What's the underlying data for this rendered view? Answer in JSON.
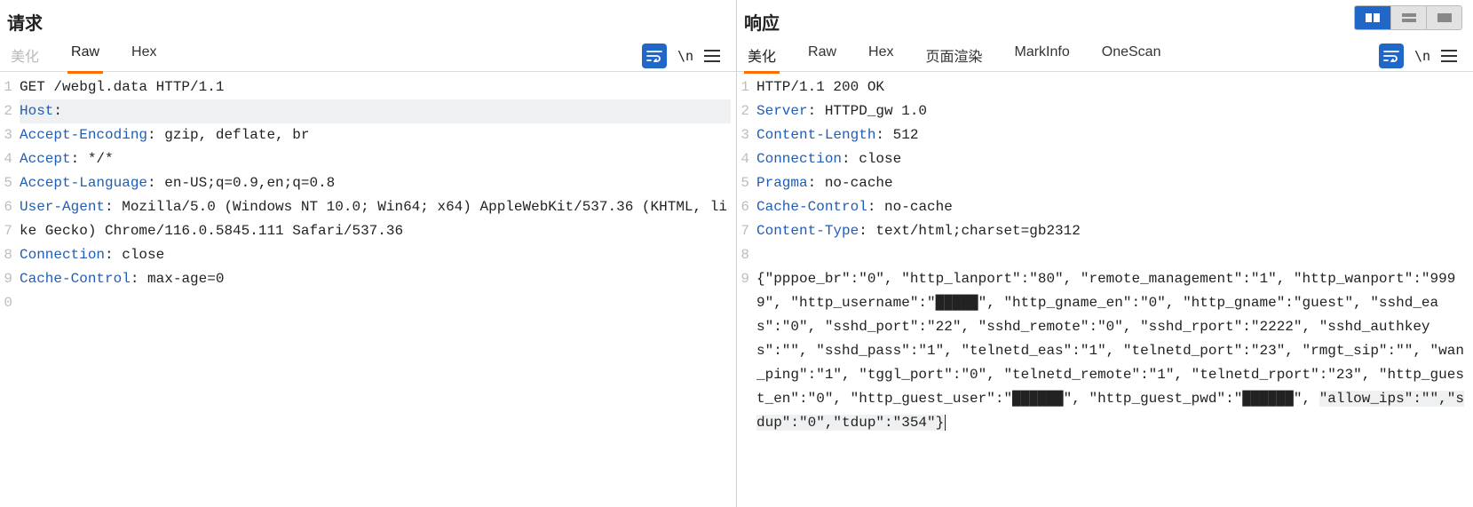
{
  "request": {
    "title": "请求",
    "tabs": [
      {
        "label": "美化",
        "state": "disabled"
      },
      {
        "label": "Raw",
        "state": "active"
      },
      {
        "label": "Hex",
        "state": ""
      }
    ],
    "toolbar": {
      "ln": "\\n"
    },
    "lines": [
      {
        "n": "1",
        "type": "plain",
        "text": "GET /webgl.data HTTP/1.1"
      },
      {
        "n": "2",
        "type": "header",
        "key": "Host",
        "value": "",
        "hl": true
      },
      {
        "n": "3",
        "type": "header",
        "key": "Accept-Encoding",
        "value": "gzip, deflate, br"
      },
      {
        "n": "4",
        "type": "header",
        "key": "Accept",
        "value": "*/*"
      },
      {
        "n": "5",
        "type": "header",
        "key": "Accept-Language",
        "value": "en-US;q=0.9,en;q=0.8"
      },
      {
        "n": "6",
        "type": "header",
        "key": "User-Agent",
        "value": "Mozilla/5.0 (Windows NT 10.0; Win64; x64) AppleWebKit/537.36 (KHTML, like Gecko) Chrome/116.0.5845.111 Safari/537.36"
      },
      {
        "n": "7",
        "type": "header",
        "key": "Connection",
        "value": "close"
      },
      {
        "n": "8",
        "type": "header",
        "key": "Cache-Control",
        "value": "max-age=0"
      },
      {
        "n": "9",
        "type": "plain",
        "text": ""
      },
      {
        "n": "0",
        "type": "plain",
        "text": ""
      }
    ]
  },
  "response": {
    "title": "响应",
    "tabs": [
      {
        "label": "美化",
        "state": "active"
      },
      {
        "label": "Raw",
        "state": ""
      },
      {
        "label": "Hex",
        "state": ""
      },
      {
        "label": "页面渲染",
        "state": ""
      },
      {
        "label": "MarkInfo",
        "state": ""
      },
      {
        "label": "OneScan",
        "state": ""
      }
    ],
    "toolbar": {
      "ln": "\\n"
    },
    "lines": [
      {
        "n": "1",
        "type": "plain",
        "text": "HTTP/1.1 200 OK"
      },
      {
        "n": "2",
        "type": "header",
        "key": "Server",
        "value": "HTTPD_gw 1.0"
      },
      {
        "n": "3",
        "type": "header",
        "key": "Content-Length",
        "value": "512"
      },
      {
        "n": "4",
        "type": "header",
        "key": "Connection",
        "value": "close"
      },
      {
        "n": "5",
        "type": "header",
        "key": "Pragma",
        "value": "no-cache"
      },
      {
        "n": "6",
        "type": "header",
        "key": "Cache-Control",
        "value": "no-cache"
      },
      {
        "n": "7",
        "type": "header",
        "key": "Content-Type",
        "value": "text/html;charset=gb2312"
      },
      {
        "n": "8",
        "type": "plain",
        "text": ""
      }
    ],
    "body_n": "9",
    "body": "{\"pppoe_br\":\"0\", \"http_lanport\":\"80\", \"remote_management\":\"1\", \"http_wanport\":\"9999\", \"http_username\":\"█████\", \"http_gname_en\":\"0\", \"http_gname\":\"guest\", \"sshd_eas\":\"0\", \"sshd_port\":\"22\", \"sshd_remote\":\"0\", \"sshd_rport\":\"2222\", \"sshd_authkeys\":\"\", \"sshd_pass\":\"1\", \"telnetd_eas\":\"1\", \"telnetd_port\":\"23\", \"rmgt_sip\":\"\", \"wan_ping\":\"1\", \"tggl_port\":\"0\", \"telnetd_remote\":\"1\", \"telnetd_rport\":\"23\", \"http_guest_en\":\"0\", \"http_guest_user\":\"██████\", \"http_guest_pwd\":\"██████\", \"allow_ips\":\"\",\"sdup\":\"0\",\"tdup\":\"354\"}"
  }
}
